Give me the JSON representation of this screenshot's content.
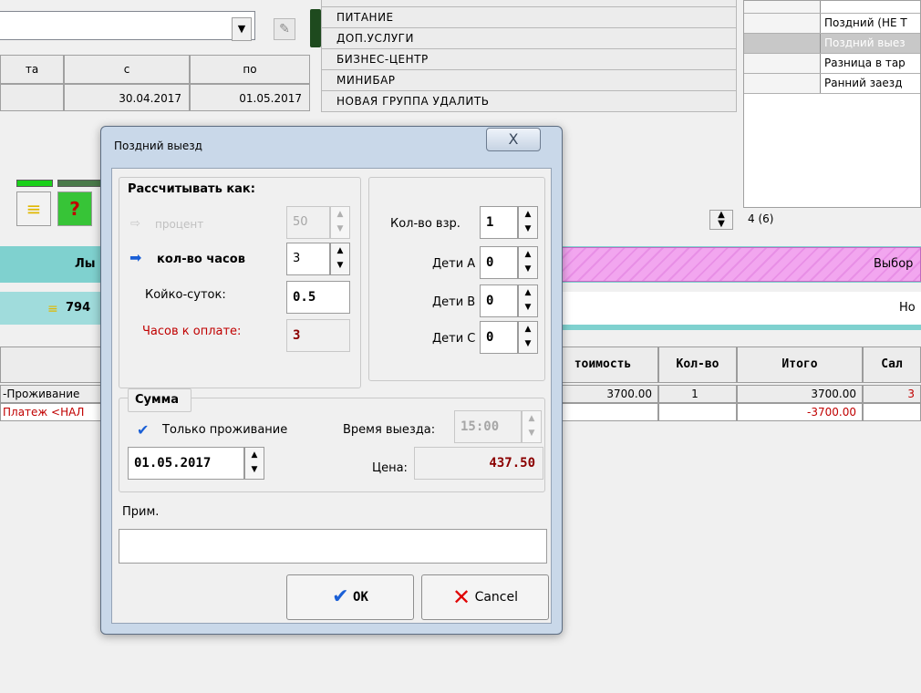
{
  "background": {
    "table_header": [
      "та",
      "с",
      "по"
    ],
    "table_values": [
      "30.04.2017",
      "01.05.2017"
    ],
    "groups": [
      "ПИТАНИЕ",
      "ДОП.УСЛУГИ",
      "БИЗНЕС-ЦЕНТР",
      "МИНИБАР",
      "НОВАЯ ГРУППА УДАЛИТЬ"
    ],
    "right_items": [
      "Поздний (НЕ Т",
      "Поздний выез",
      "Разница в тар",
      "Ранний заезд"
    ],
    "count_label": "4 (6)",
    "band_left_text": "Лы",
    "band_right_text": "Выбор",
    "amount_text": "794",
    "right_no_text": "Но",
    "services_headers": [
      "тоимость",
      "Кол-во",
      "Итого",
      "Сал"
    ],
    "service_rows": [
      {
        "name": "-Проживание",
        "price": "3700.00",
        "qty": "1",
        "total": "3700.00",
        "bal": "3"
      },
      {
        "name": "Платеж <НАЛ",
        "price": "",
        "qty": "",
        "total": "-3700.00",
        "bal": ""
      }
    ]
  },
  "dialog": {
    "title": "Поздний выезд",
    "close_glyph": "X",
    "calc": {
      "heading": "Рассчитывать как:",
      "percent_label": "процент",
      "percent_value": "50",
      "hours_label": "кол-во часов",
      "hours_value": "3",
      "nights_label": "Койко-суток:",
      "nights_value": "0.5",
      "pay_hours_label": "Часов к оплате:",
      "pay_hours_value": "3"
    },
    "guests": {
      "adults_label": "Кол-во взр.",
      "adults_value": "1",
      "child_a_label": "Дети А",
      "child_a_value": "0",
      "child_b_label": "Дети В",
      "child_b_value": "0",
      "child_c_label": "Дети С",
      "child_c_value": "0"
    },
    "sum": {
      "heading": "Сумма",
      "only_living_label": "Только проживание",
      "only_living_checked": true,
      "checkout_time_label": "Время выезда:",
      "checkout_time_value": "15:00",
      "date_value": "01.05.2017",
      "price_label": "Цена:",
      "price_value": "437.50"
    },
    "note_label": "Прим.",
    "note_value": "",
    "ok_label": "OK",
    "cancel_label": "Cancel"
  },
  "colors": {
    "dialog_frame": "#c9d8e9",
    "client_bg": "#f0f0f0",
    "accent_blue": "#1a5fd6",
    "red_label": "#c00000",
    "price_value": "#8b0000",
    "cyan_band": "#7fd1cf",
    "pink_band": "#f2a6ef"
  }
}
